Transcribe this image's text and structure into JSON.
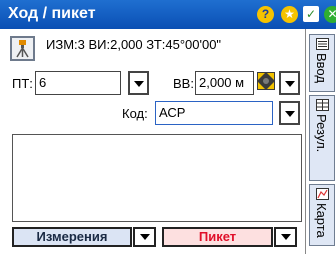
{
  "window": {
    "title": "Ход / пикет"
  },
  "status": {
    "text": "ИЗМ:3  ВИ:2,000  ЗТ:45°00'00\""
  },
  "fields": {
    "pt_label": "ПТ:",
    "pt_value": "6",
    "vv_label": "ВВ:",
    "vv_value": "2,000 м",
    "code_label": "Код:",
    "code_value": "АСР"
  },
  "buttons": {
    "measurements": "Измерения",
    "picket": "Пикет"
  },
  "side_tabs": [
    "Ввод",
    "Резул.",
    "Карта"
  ],
  "icons": {
    "help": "help-icon",
    "star": "star-icon",
    "check": "check-icon",
    "close": "close-icon",
    "instrument": "tripod-icon",
    "multi": "target-icon"
  },
  "colors": {
    "titlebar": "#0a4fb4",
    "picket_text": "#e0102a",
    "tab_bg": "#dfe7f5"
  }
}
